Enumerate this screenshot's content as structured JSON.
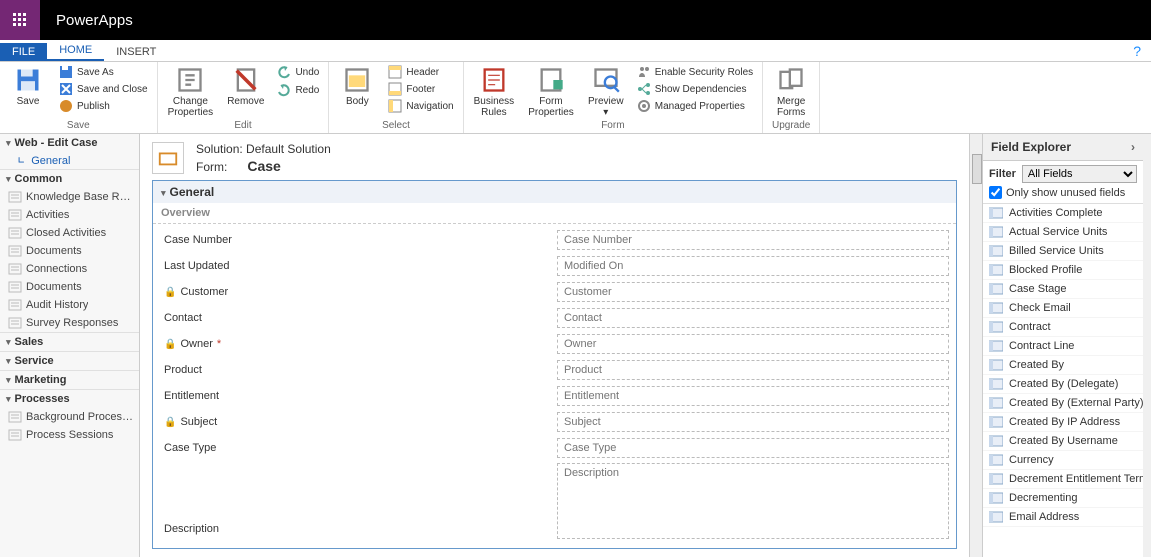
{
  "brand": "PowerApps",
  "tabs": {
    "file": "FILE",
    "home": "HOME",
    "insert": "INSERT"
  },
  "ribbon": {
    "save": {
      "save": "Save",
      "saveAs": "Save As",
      "saveClose": "Save and Close",
      "publish": "Publish",
      "group": "Save"
    },
    "edit": {
      "changeProps": "Change\nProperties",
      "remove": "Remove",
      "undo": "Undo",
      "redo": "Redo",
      "group": "Edit"
    },
    "select": {
      "body": "Body",
      "header": "Header",
      "footer": "Footer",
      "navigation": "Navigation",
      "group": "Select"
    },
    "form": {
      "bizRules": "Business\nRules",
      "formProps": "Form\nProperties",
      "preview": "Preview",
      "enableSec": "Enable Security Roles",
      "showDeps": "Show Dependencies",
      "managedProps": "Managed Properties",
      "group": "Form"
    },
    "upgrade": {
      "merge": "Merge\nForms",
      "group": "Upgrade"
    }
  },
  "leftnav": {
    "webEdit": "Web - Edit Case",
    "general": "General",
    "common": "Common",
    "commonItems": [
      "Knowledge Base Reco…",
      "Activities",
      "Closed Activities",
      "Documents",
      "Connections",
      "Documents",
      "Audit History",
      "Survey Responses"
    ],
    "sales": "Sales",
    "service": "Service",
    "marketing": "Marketing",
    "processes": "Processes",
    "processItems": [
      "Background Processes",
      "Process Sessions"
    ]
  },
  "formHeader": {
    "solutionLabel": "Solution:",
    "solutionValue": "Default Solution",
    "formLabel": "Form:",
    "formValue": "Case"
  },
  "section": {
    "general": "General",
    "overview": "Overview"
  },
  "fields": [
    {
      "label": "Case Number",
      "ph": "Case Number",
      "locked": false,
      "required": false
    },
    {
      "label": "Last Updated",
      "ph": "Modified On",
      "locked": false,
      "required": false
    },
    {
      "label": "Customer",
      "ph": "Customer",
      "locked": true,
      "required": false
    },
    {
      "label": "Contact",
      "ph": "Contact",
      "locked": false,
      "required": false
    },
    {
      "label": "Owner",
      "ph": "Owner",
      "locked": true,
      "required": true
    },
    {
      "label": "Product",
      "ph": "Product",
      "locked": false,
      "required": false
    },
    {
      "label": "Entitlement",
      "ph": "Entitlement",
      "locked": false,
      "required": false
    },
    {
      "label": "Subject",
      "ph": "Subject",
      "locked": true,
      "required": false
    },
    {
      "label": "Case Type",
      "ph": "Case Type",
      "locked": false,
      "required": false
    }
  ],
  "descField": {
    "label": "Description",
    "ph": "Description"
  },
  "rightPanel": {
    "title": "Field Explorer",
    "filterLabel": "Filter",
    "filterValue": "All Fields",
    "onlyUnused": "Only show unused fields",
    "items": [
      "Activities Complete",
      "Actual Service Units",
      "Billed Service Units",
      "Blocked Profile",
      "Case Stage",
      "Check Email",
      "Contract",
      "Contract Line",
      "Created By",
      "Created By (Delegate)",
      "Created By (External Party)",
      "Created By IP Address",
      "Created By Username",
      "Currency",
      "Decrement Entitlement Terms",
      "Decrementing",
      "Email Address"
    ]
  }
}
